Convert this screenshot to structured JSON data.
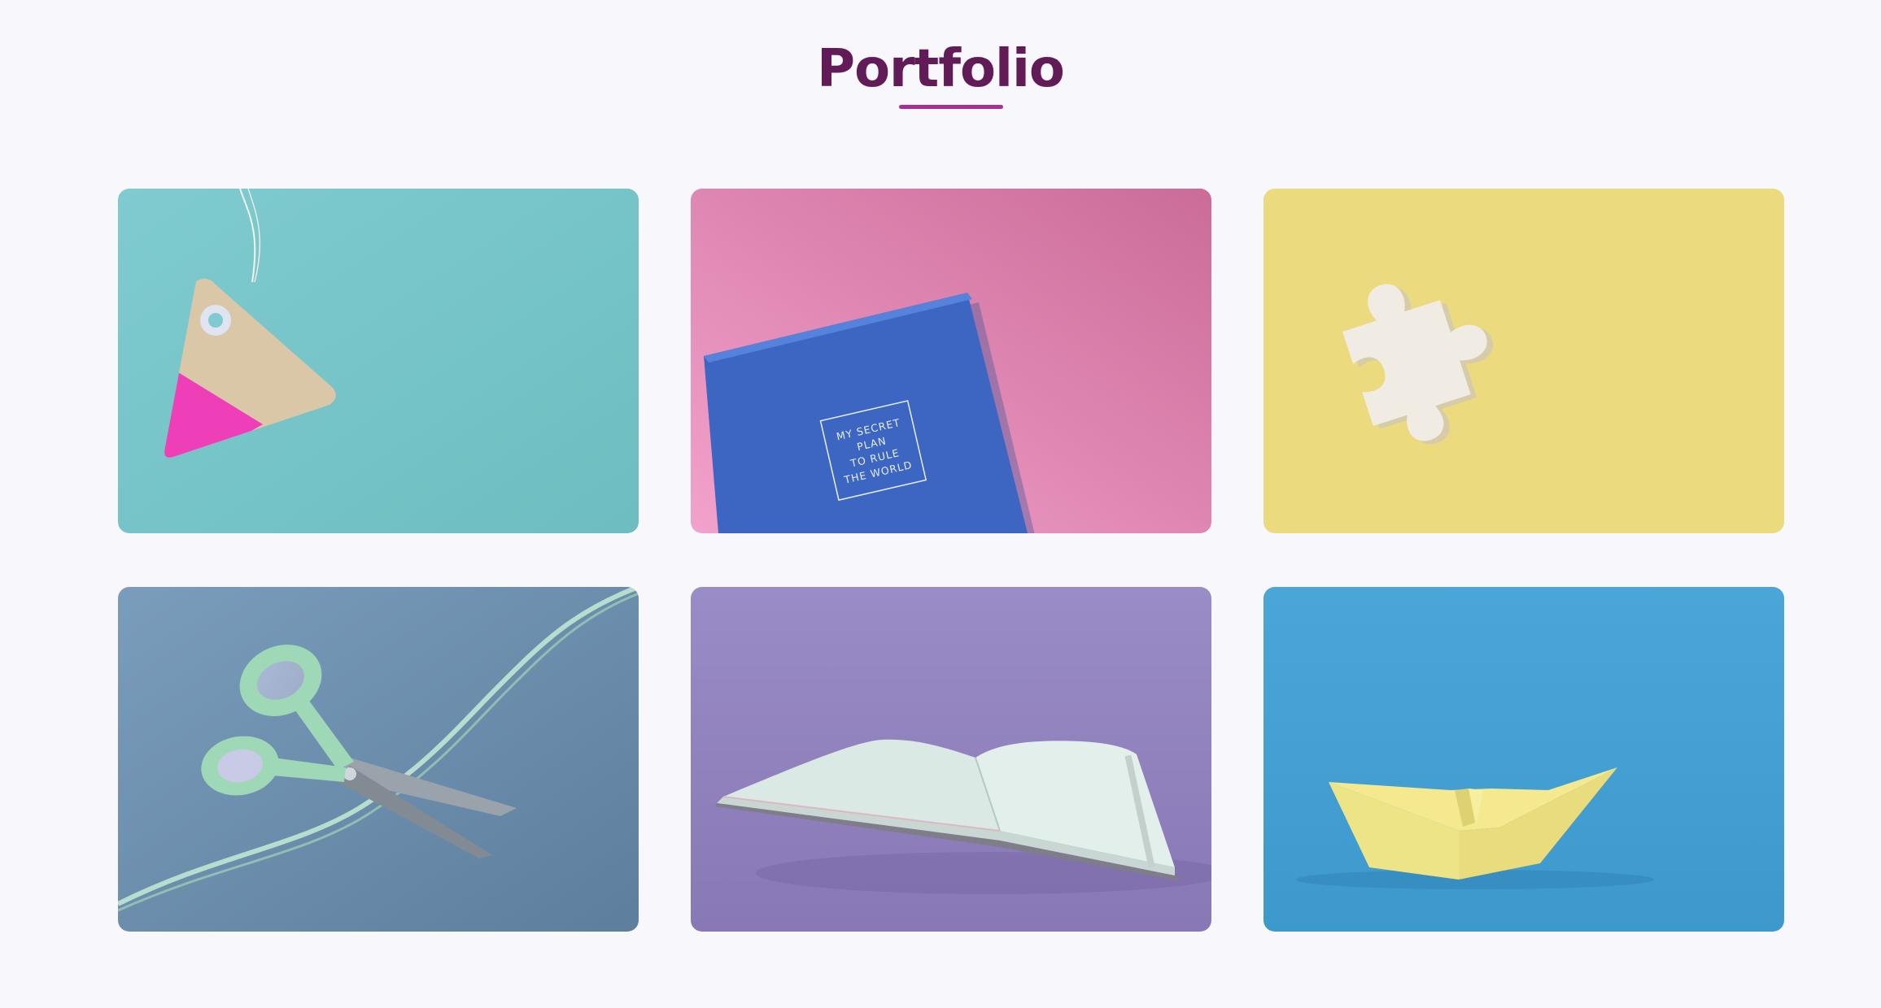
{
  "header": {
    "title": "Portfolio"
  },
  "colors": {
    "title": "#611c58",
    "underline": "#a82f99",
    "background": "#f8f7fc"
  },
  "portfolio": {
    "items": [
      {
        "subject": "tag",
        "background": "#77c5c8"
      },
      {
        "subject": "notebook",
        "background": "#e08cba",
        "cover_lines": [
          "MY SECRET",
          "PLAN",
          "TO RULE",
          "THE WORLD"
        ]
      },
      {
        "subject": "puzzle-piece",
        "background": "#ecdc80"
      },
      {
        "subject": "scissors",
        "background": "#6a8fae"
      },
      {
        "subject": "open-book",
        "background": "#978bc4"
      },
      {
        "subject": "paper-boat",
        "background": "#4ea7d7"
      }
    ]
  }
}
